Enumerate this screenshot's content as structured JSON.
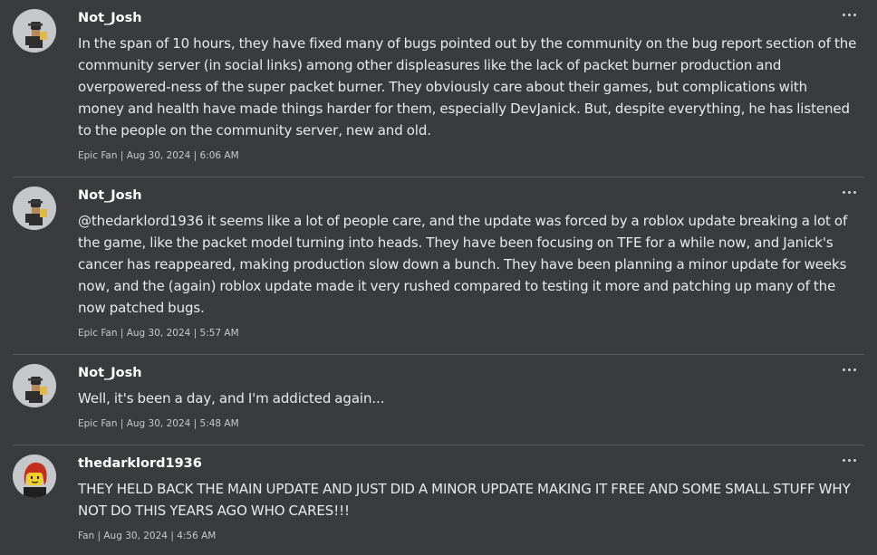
{
  "comments": [
    {
      "author": "Not_Josh",
      "avatar_icon": "grey-avatar-icon",
      "text": "In the span of 10 hours, they have fixed many of bugs pointed out by the community on the bug report section of the community server (in social links) among other displeasures like the lack of packet burner production and overpowered-ness of the super packet burner. They obviously care about their games, but complications with money and health have made things harder for them, especially DevJanick. But, despite everything, he has listened to the people on the community server, new and old.",
      "meta": "Epic Fan | Aug 30, 2024 | 6:06 AM"
    },
    {
      "author": "Not_Josh",
      "avatar_icon": "grey-avatar-icon",
      "text": "@thedarklord1936 it seems like a lot of people care, and the update was forced by a roblox update breaking a lot of the game, like the packet model turning into heads. They have been focusing on TFE for a while now, and Janick's cancer has reappeared, making production slow down a bunch. They have been planning a minor update for weeks now, and the (again) roblox update made it very rushed compared to testing it more and patching up many of the now patched bugs.",
      "meta": "Epic Fan | Aug 30, 2024 | 5:57 AM"
    },
    {
      "author": "Not_Josh",
      "avatar_icon": "grey-avatar-icon",
      "text": "Well, it's been a day, and I'm addicted again...",
      "meta": "Epic Fan | Aug 30, 2024 | 5:48 AM"
    },
    {
      "author": "thedarklord1936",
      "avatar_icon": "red-hair-avatar-icon",
      "text": "THEY HELD BACK THE MAIN UPDATE AND JUST DID A MINOR UPDATE MAKING IT FREE AND SOME SMALL STUFF WHY NOT DO THIS YEARS AGO WHO CARES!!!",
      "meta": "Fan | Aug 30, 2024 | 4:56 AM"
    }
  ],
  "more_icon": "more-options-icon",
  "colors": {
    "background": "#393b3d",
    "divider": "#5b5d60",
    "author": "#ffffff",
    "text": "#e8e9ea",
    "meta": "#c8c9ca"
  }
}
